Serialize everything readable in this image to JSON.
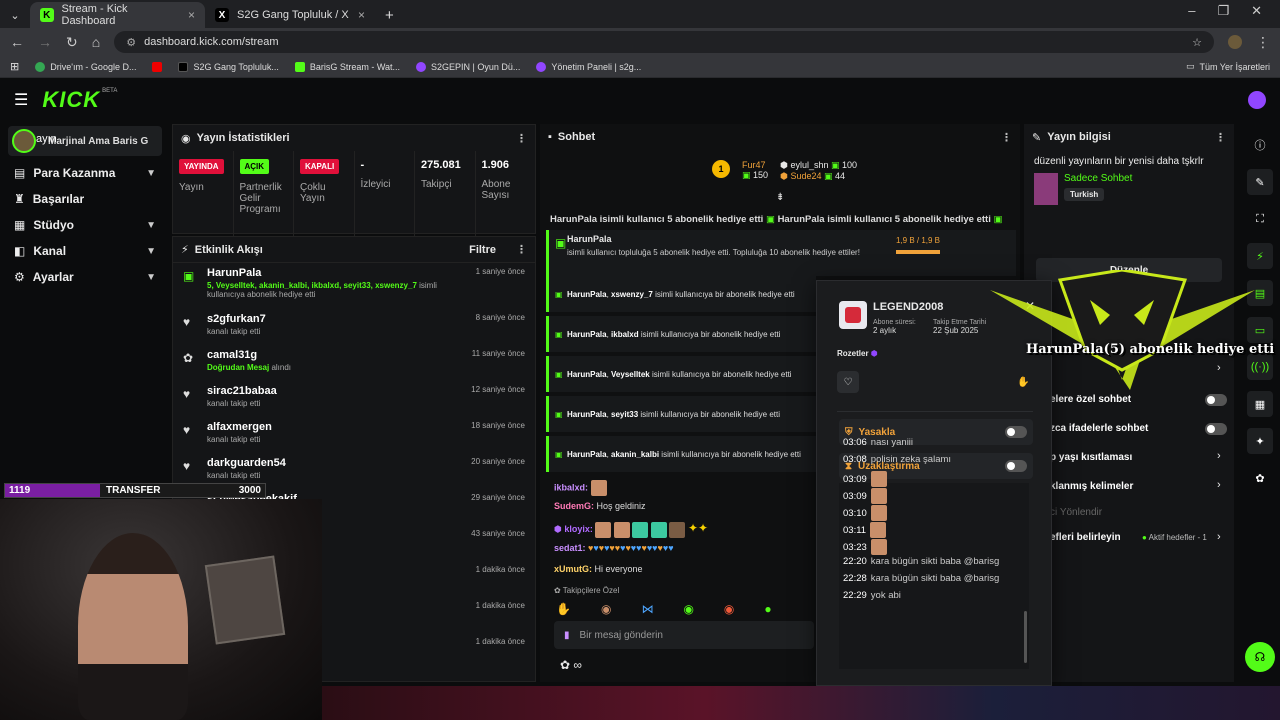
{
  "browser": {
    "tabs": [
      {
        "title": "Stream - Kick Dashboard",
        "active": true
      },
      {
        "title": "S2G Gang Topluluk / X",
        "active": false
      }
    ],
    "url": "dashboard.kick.com/stream",
    "bookmarks": [
      "Drive'ım - Google D...",
      "S2G Gang Topluluk...",
      "BarisG Stream - Wat...",
      "S2GEPIN | Oyun Dü...",
      "Yönetim Paneli | s2g..."
    ],
    "bookmarks_all": "Tüm Yer İşaretleri"
  },
  "kick": {
    "logo": "KICK",
    "beta": "BETA"
  },
  "nav": {
    "channel": "Marjinal Ama Baris G",
    "channel_overlap": "ayın",
    "items": [
      {
        "label": "Para Kazanma",
        "chev": true
      },
      {
        "label": "Başarılar",
        "chev": false
      },
      {
        "label": "Stüdyo",
        "chev": true
      },
      {
        "label": "Kanal",
        "chev": true
      },
      {
        "label": "Ayarlar",
        "chev": true
      }
    ]
  },
  "stats": {
    "title": "Yayın İstatistikleri",
    "cols": [
      {
        "badge": "YAYINDA",
        "label": "Yayın"
      },
      {
        "badge": "AÇIK",
        "label": "Partnerlik Gelir Programı"
      },
      {
        "badge": "KAPALI",
        "label": "Çoklu Yayın"
      },
      {
        "value": "-",
        "label": "İzleyici"
      },
      {
        "value": "275.081",
        "label": "Takipçi"
      },
      {
        "value": "1.906",
        "label": "Abone Sayısı"
      }
    ]
  },
  "feed": {
    "title": "Etkinlik Akışı",
    "filter": "Filtre",
    "items": [
      {
        "name": "HarunPala",
        "desc_g": "5, Veyselltek, akanin_kalbi, ikbalxd, seyit33, xswenzy_7",
        "desc": " isimli kullanıcıya abonelik hediye etti",
        "time": "1 saniye önce"
      },
      {
        "name": "s2gfurkan7",
        "desc": "kanalı takip etti",
        "time": "8 saniye önce"
      },
      {
        "name": "camal31g",
        "desc_g": "Doğrudan Mesaj",
        "desc": " alındı",
        "time": "11 saniye önce"
      },
      {
        "name": "sirac21babaa",
        "desc": "kanalı takip etti",
        "time": "12 saniye önce"
      },
      {
        "name": "alfaxmergen",
        "desc": "kanalı takip etti",
        "time": "18 saniye önce"
      },
      {
        "name": "darkguarden54",
        "desc": "kanalı takip etti",
        "time": "20 saniye önce"
      },
      {
        "name": "schwesaneekakif",
        "desc": "",
        "time": "29 saniye önce"
      },
      {
        "name": "",
        "desc": "",
        "time": "43 saniye önce"
      },
      {
        "name": "",
        "desc": "",
        "time": "1 dakika önce"
      },
      {
        "name": "",
        "desc": "",
        "time": "1 dakika önce"
      },
      {
        "name": "",
        "desc": "",
        "time": "1 dakika önce"
      }
    ]
  },
  "chat": {
    "title": "Sohbet",
    "leaders": [
      {
        "rank": "1",
        "name": "Fur47",
        "val": "150"
      },
      {
        "name": "eylul_shn",
        "val": "100"
      },
      {
        "name": "Sude24",
        "val": "44"
      }
    ],
    "ticker": "HarunPala isimli kullanıcı 5 abonelik hediye etti",
    "pinned": {
      "name": "HarunPala",
      "text": "isimli kullanıcı topluluğa 5 abonelik hediye etti. Topluluğa 10 abonelik hediye ettiler!",
      "progress": "1,9 B / 1,9 B"
    },
    "gifts": [
      {
        "name": "HarunPala",
        "target": "xswenzy_7",
        "text": " isimli kullanıcıya bir abonelik hediye etti"
      },
      {
        "name": "HarunPala",
        "target": "ikbalxd",
        "text": " isimli kullanıcıya bir abonelik hediye etti"
      },
      {
        "name": "HarunPala",
        "target": "Veyselltek",
        "text": " isimli kullanıcıya bir abonelik hediye etti"
      },
      {
        "name": "HarunPala",
        "target": "seyit33",
        "text": " isimli kullanıcıya bir abonelik hediye etti"
      },
      {
        "name": "HarunPala",
        "target": "akanin_kalbi",
        "text": " isimli kullanıcıya bir abonelik hediye etti"
      }
    ],
    "messages": [
      {
        "user": "ikbalxd:",
        "text": ""
      },
      {
        "user": "SudemG:",
        "text": "Hoş geldiniz"
      },
      {
        "user": "kloyix:",
        "text": ""
      },
      {
        "user": "sedat1:",
        "text": ""
      },
      {
        "user": "xUmutG:",
        "text": "Hi everyone"
      }
    ],
    "followers_only": "Takipçilere Özel",
    "input_placeholder": "Bir mesaj gönderin"
  },
  "info": {
    "title": "Yayın bilgisi",
    "stream_title": "düzenli yayınların bir yenisi daha tşkrlr",
    "category": "Sadece Sohbet",
    "language": "Turkish",
    "edit": "Düzenle",
    "settings": [
      {
        "label": "elere özel sohbet"
      },
      {
        "label": "zca ifadelerle sohbet"
      },
      {
        "label": "p yaşı kısıtlaması"
      },
      {
        "label": "klanmış kelimeler"
      },
      {
        "label": "ci Yönlendir"
      },
      {
        "label": "efleri belirleyin",
        "extra": "Aktif hedefler - 1"
      }
    ]
  },
  "usercard": {
    "username": "LEGEND2008",
    "sub_label": "Abone süresi:",
    "sub_value": "2 aylık",
    "follow_label": "Takip Etme Tarihi",
    "follow_value": "22 Şub 2025",
    "badges_label": "Rozetler",
    "ban": "Yasakla",
    "timeout": "Uzaklaştırma",
    "log": [
      {
        "t": "03:06",
        "m": "nası yaniii"
      },
      {
        "t": "03:08",
        "m": "polisin zeka şalamı"
      },
      {
        "t": "03:09",
        "m": ""
      },
      {
        "t": "03:09",
        "m": ""
      },
      {
        "t": "03:10",
        "m": ""
      },
      {
        "t": "03:11",
        "m": ""
      },
      {
        "t": "03:23",
        "m": ""
      },
      {
        "t": "22:20",
        "m": "kara bügün sikti baba @barisg"
      },
      {
        "t": "22:28",
        "m": "kara bügün sikti baba @barisg"
      },
      {
        "t": "22:29",
        "m": "yok abi"
      }
    ]
  },
  "overlay": {
    "text": "HarunPala(5) abonelik hediye etti"
  },
  "transfer": {
    "left": "1119",
    "mid": "TRANSFER",
    "right": "3000"
  },
  "colors": {
    "accent": "#53fc18",
    "live": "#e0103a",
    "bg": "#0b0c0d"
  }
}
